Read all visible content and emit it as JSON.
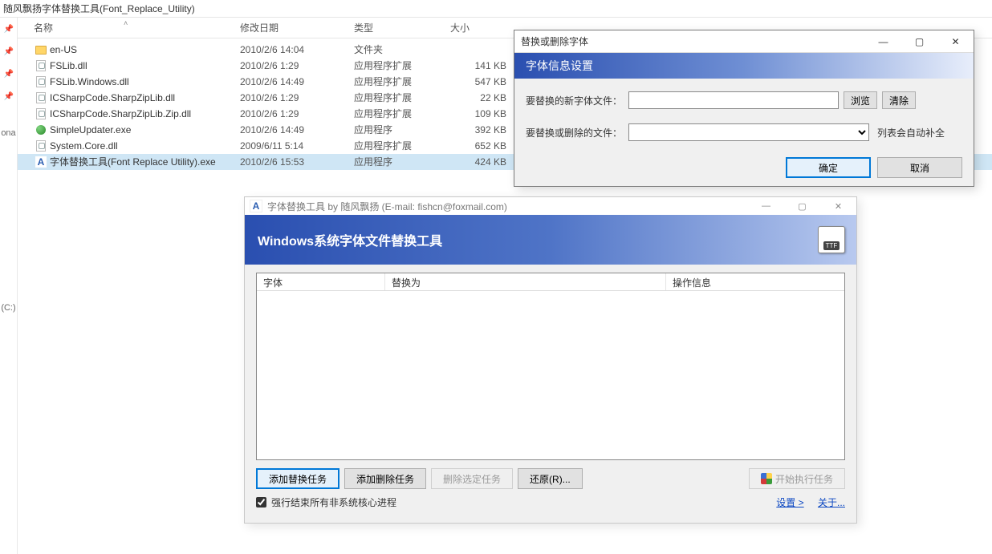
{
  "explorer": {
    "address": "随风飘扬字体替换工具(Font_Replace_Utility)",
    "leftrail": {
      "ona": "ona",
      "drive": "(C:)"
    },
    "columns": {
      "name": "名称",
      "date": "修改日期",
      "type": "类型",
      "size": "大小"
    },
    "files": [
      {
        "icon": "folder",
        "name": "en-US",
        "date": "2010/2/6 14:04",
        "type": "文件夹",
        "size": ""
      },
      {
        "icon": "dll",
        "name": "FSLib.dll",
        "date": "2010/2/6 1:29",
        "type": "应用程序扩展",
        "size": "141 KB"
      },
      {
        "icon": "dll",
        "name": "FSLib.Windows.dll",
        "date": "2010/2/6 14:49",
        "type": "应用程序扩展",
        "size": "547 KB"
      },
      {
        "icon": "dll",
        "name": "ICSharpCode.SharpZipLib.dll",
        "date": "2010/2/6 1:29",
        "type": "应用程序扩展",
        "size": "22 KB"
      },
      {
        "icon": "dll",
        "name": "ICSharpCode.SharpZipLib.Zip.dll",
        "date": "2010/2/6 1:29",
        "type": "应用程序扩展",
        "size": "109 KB"
      },
      {
        "icon": "exe",
        "name": "SimpleUpdater.exe",
        "date": "2010/2/6 14:49",
        "type": "应用程序",
        "size": "392 KB"
      },
      {
        "icon": "dll",
        "name": "System.Core.dll",
        "date": "2009/6/11 5:14",
        "type": "应用程序扩展",
        "size": "652 KB"
      },
      {
        "icon": "font",
        "name": "字体替换工具(Font Replace Utility).exe",
        "date": "2010/2/6 15:53",
        "type": "应用程序",
        "size": "424 KB",
        "selected": true
      }
    ]
  },
  "dlg1": {
    "title": "替换或删除字体",
    "banner": "字体信息设置",
    "row1_label": "要替换的新字体文件：",
    "row1_browse": "浏览",
    "row1_clear": "清除",
    "row2_label": "要替换或删除的文件：",
    "row2_hint": "列表会自动补全",
    "ok": "确定",
    "cancel": "取消"
  },
  "dlg2": {
    "title": "字体替换工具 by 随风飘扬 (E-mail: fishcn@foxmail.com)",
    "banner": "Windows系统字体文件替换工具",
    "ttf": "TTF",
    "col1": "字体",
    "col2": "替换为",
    "col3": "操作信息",
    "btn_add_replace": "添加替换任务",
    "btn_add_delete": "添加删除任务",
    "btn_del_sel": "删除选定任务",
    "btn_restore": "还原(R)...",
    "btn_start": "开始执行任务",
    "chk_label": "强行结束所有非系统核心进程",
    "chk_checked": true,
    "link_settings": "设置 >",
    "link_about": "关于..."
  }
}
